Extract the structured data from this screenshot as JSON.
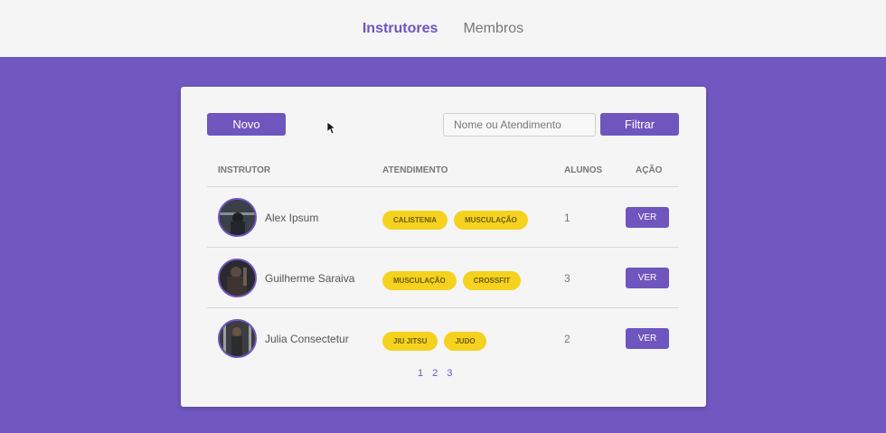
{
  "nav": {
    "instructors": "Instrutores",
    "members": "Membros"
  },
  "toolbar": {
    "new_label": "Novo",
    "search_placeholder": "Nome ou Atendimento",
    "filter_label": "Filtrar"
  },
  "table": {
    "headers": [
      "INSTRUTOR",
      "ATENDIMENTO",
      "ALUNOS",
      "AÇÃO"
    ],
    "rows": [
      {
        "name": "Alex Ipsum",
        "tags": [
          "CALISTENIA",
          "MUSCULAÇÃO"
        ],
        "students": "1",
        "action": "VER"
      },
      {
        "name": "Guilherme Saraiva",
        "tags": [
          "MUSCULAÇÃO",
          "CROSSFIT"
        ],
        "students": "3",
        "action": "VER"
      },
      {
        "name": "Julia Consectetur",
        "tags": [
          "JIU JITSU",
          "JUDO"
        ],
        "students": "2",
        "action": "VER"
      }
    ]
  },
  "pagination": [
    "1",
    "2",
    "3"
  ],
  "colors": {
    "primary": "#6f55be",
    "background": "#7157c0",
    "tag": "#f5d21d"
  }
}
